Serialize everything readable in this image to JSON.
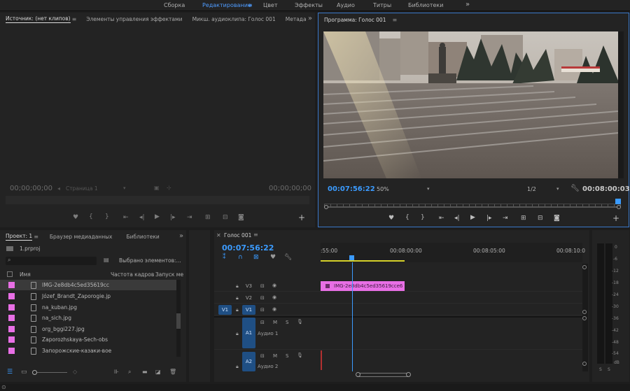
{
  "workspaces": [
    {
      "label": "Сборка",
      "active": false
    },
    {
      "label": "Редактирование",
      "active": true
    },
    {
      "label": "Цвет",
      "active": false
    },
    {
      "label": "Эффекты",
      "active": false
    },
    {
      "label": "Аудио",
      "active": false
    },
    {
      "label": "Титры",
      "active": false
    },
    {
      "label": "Библиотеки",
      "active": false
    }
  ],
  "workspace_menu_glyph": "≡",
  "more_glyph": "»",
  "source_panel": {
    "tabs": [
      "Источник: (нет клипов)",
      "Элементы управления эффектами",
      "Микш. аудиоклипа: Голос 001",
      "Метада"
    ],
    "timecode_left": "00;00;00;00",
    "timecode_right": "00;00;00;00",
    "page_label": "Страница 1"
  },
  "program_panel": {
    "title": "Программа: Голос 001",
    "timecode": "00:07:56:22",
    "zoom": "50%",
    "resolution": "1/2",
    "duration": "00:08:00:03"
  },
  "project_panel": {
    "tabs": [
      "Проект: 1",
      "Браузер медиаданных",
      "Библиотеки"
    ],
    "project_file": "1.prproj",
    "search_placeholder": "",
    "selected_label": "Выбрано элементов:...",
    "columns": [
      "Имя",
      "Частота кадров",
      "Запуск ме"
    ],
    "files": [
      "IMG-2e8db4c5ed35619cc",
      "Józef_Brandt_Zaporogie.jp",
      "na_kuban.jpg",
      "na_sich.jpg",
      "org_bggi227.jpg",
      "Zaporozhskaya-Sech-obs",
      "Запорожские-казаки-вое"
    ]
  },
  "timeline_panel": {
    "tab": "Голос 001",
    "timecode": "00:07:56:22",
    "ruler": [
      ":55:00",
      "00:08:00:00",
      "00:08:05:00",
      "00:08:10:0"
    ],
    "video_tracks": [
      "V3",
      "V2",
      "V1"
    ],
    "audio_tracks": [
      {
        "id": "A1",
        "name": "Аудио 1"
      },
      {
        "id": "A2",
        "name": "Аудио 2"
      }
    ],
    "source_patch": "V1",
    "clip_name": "IMG-2e8db4c5ed35619cce6",
    "mute": "M",
    "solo": "S"
  },
  "audio_meter": {
    "scale": [
      "0",
      "-6",
      "-12",
      "-18",
      "-24",
      "-30",
      "-36",
      "-42",
      "-48",
      "-54",
      "dB"
    ],
    "footer": [
      "S",
      "S"
    ]
  },
  "colors": {
    "accent": "#3b9bff",
    "clip": "#e86fe5",
    "track_on": "#1f4f84"
  }
}
